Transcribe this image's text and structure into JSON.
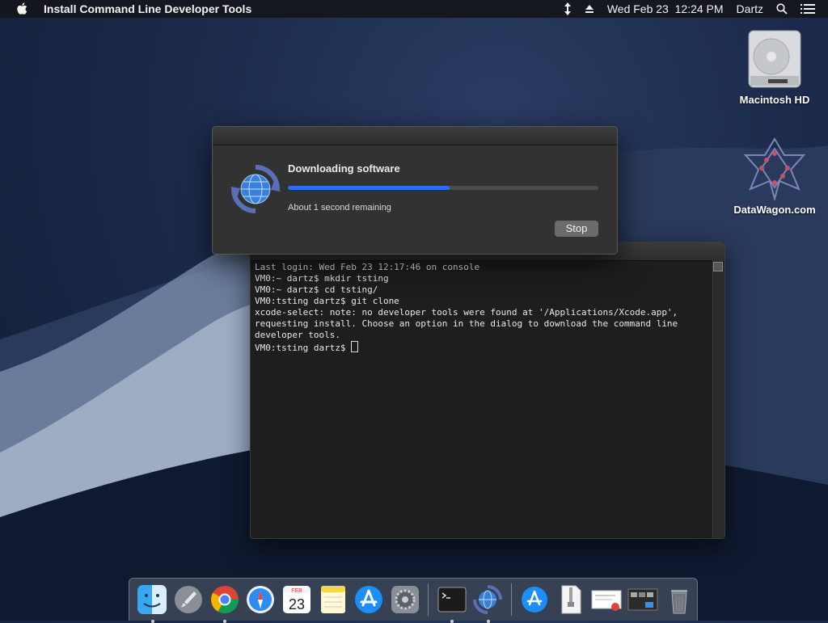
{
  "menubar": {
    "app_name": "Install Command Line Developer Tools",
    "datetime": "Wed Feb 23  12:24 PM",
    "user": "Dartz",
    "icons": [
      "apple-icon",
      "split-arrows-icon",
      "eject-icon",
      "search-icon",
      "list-icon"
    ]
  },
  "desktop": {
    "icons": [
      {
        "label": "Macintosh HD",
        "icon": "hard-drive-icon"
      },
      {
        "label": "DataWagon.com",
        "icon": "datawagon-logo-icon"
      }
    ]
  },
  "dialog": {
    "title": "Downloading software",
    "status": "About 1 second remaining",
    "progress_fraction": 0.52,
    "stop_label": "Stop",
    "icon": "software-update-icon"
  },
  "terminal": {
    "lines": [
      "Last login: Wed Feb 23 12:17:46 on console",
      "VM0:~ dartz$ mkdir tsting",
      "VM0:~ dartz$ cd tsting/",
      "VM0:tsting dartz$ git clone",
      "xcode-select: note: no developer tools were found at '/Applications/Xcode.app',",
      "requesting install. Choose an option in the dialog to download the command line",
      "developer tools.",
      "VM0:tsting dartz$ "
    ]
  },
  "dock": {
    "items": [
      {
        "name": "finder-icon",
        "running": true
      },
      {
        "name": "launchpad-icon",
        "running": false
      },
      {
        "name": "chrome-icon",
        "running": true
      },
      {
        "name": "safari-icon",
        "running": false
      },
      {
        "name": "calendar-icon",
        "running": false,
        "month": "FEB",
        "day": "23"
      },
      {
        "name": "notes-icon",
        "running": false
      },
      {
        "name": "app-store-icon",
        "running": false
      },
      {
        "name": "system-preferences-icon",
        "running": false
      },
      {
        "name": "terminal-icon",
        "running": true
      },
      {
        "name": "software-update-icon",
        "running": true
      },
      {
        "name": "applications-folder-icon",
        "running": false
      },
      {
        "name": "zip-file-icon",
        "running": false
      },
      {
        "name": "document-thumbnail-icon",
        "running": false
      },
      {
        "name": "screenshot-thumbnail-icon",
        "running": false
      },
      {
        "name": "trash-icon",
        "running": false
      }
    ]
  },
  "colors": {
    "progress": "#2b6cf3",
    "desktop_bg": "#1b2a4a"
  }
}
